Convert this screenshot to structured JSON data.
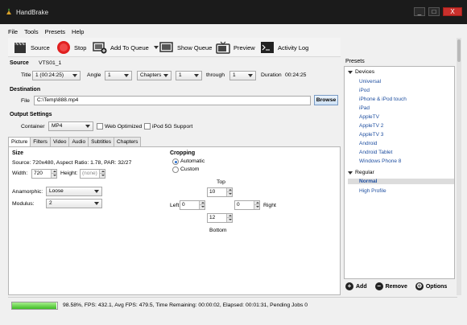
{
  "window": {
    "title": "HandBrake",
    "controls": [
      "_",
      "□",
      "X"
    ]
  },
  "menu": [
    "File",
    "Tools",
    "Presets",
    "Help"
  ],
  "toolbar": {
    "source": "Source",
    "stop": "Stop",
    "add_to_queue": "Add To Queue",
    "show_queue": "Show Queue",
    "preview": "Preview",
    "activity_log": "Activity Log"
  },
  "source": {
    "section": "Source",
    "name": "VTS01_1",
    "title_label": "Title",
    "title_value": "1 (00:24:25)",
    "angle_label": "Angle",
    "angle_value": "1",
    "range_mode": "Chapters",
    "range_start": "1",
    "through_label": "through",
    "range_end": "1",
    "duration_label": "Duration",
    "duration_value": "00:24:25"
  },
  "destination": {
    "section": "Destination",
    "file_label": "File",
    "file_value": "C:\\Temp\\888.mp4",
    "browse": "Browse"
  },
  "output": {
    "section": "Output Settings",
    "container_label": "Container",
    "container_value": "MP4",
    "web_optimized": "Web Optimized",
    "web_optimized_checked": false,
    "ipod_support": "iPod 5G Support",
    "ipod_support_checked": false
  },
  "tabs": [
    "Picture",
    "Filters",
    "Video",
    "Audio",
    "Subtitles",
    "Chapters"
  ],
  "active_tab": "Picture",
  "picture": {
    "size_title": "Size",
    "source_info": "Source:  720x480, Aspect Ratio: 1.78, PAR: 32/27",
    "width_label": "Width:",
    "width_value": "720",
    "height_label": "Height:",
    "height_value": "(none)",
    "anamorphic_label": "Anamorphic:",
    "anamorphic_value": "Loose",
    "modulus_label": "Modulus:",
    "modulus_value": "2",
    "cropping_title": "Cropping",
    "crop_automatic": "Automatic",
    "crop_custom": "Custom",
    "crop_mode": "Automatic",
    "top_label": "Top",
    "top_value": "10",
    "left_label": "Left",
    "left_value": "0",
    "right_label": "Right",
    "right_value": "0",
    "bottom_value": "12",
    "bottom_label": "Bottom"
  },
  "presets": {
    "title": "Presets",
    "devices_label": "Devices",
    "devices": [
      "Universal",
      "iPod",
      "iPhone & iPod touch",
      "iPad",
      "AppleTV",
      "AppleTV 2",
      "AppleTV 3",
      "Android",
      "Android Tablet",
      "Windows Phone 8"
    ],
    "regular_label": "Regular",
    "regular": [
      "Normal",
      "High Profile"
    ],
    "selected": "Normal",
    "add": "Add",
    "remove": "Remove",
    "options": "Options"
  },
  "status": {
    "progress_percent": 98.58,
    "text": "98.58%,  FPS: 432.1,  Avg FPS: 479.5,  Time Remaining: 00:00:02,  Elapsed: 00:01:31,  Pending Jobs 0"
  },
  "colors": {
    "titlebar": "#1b1b1b",
    "close_button": "#c9302c",
    "preset_link": "#1f4fa0",
    "progress_green": "#3fbd26"
  }
}
